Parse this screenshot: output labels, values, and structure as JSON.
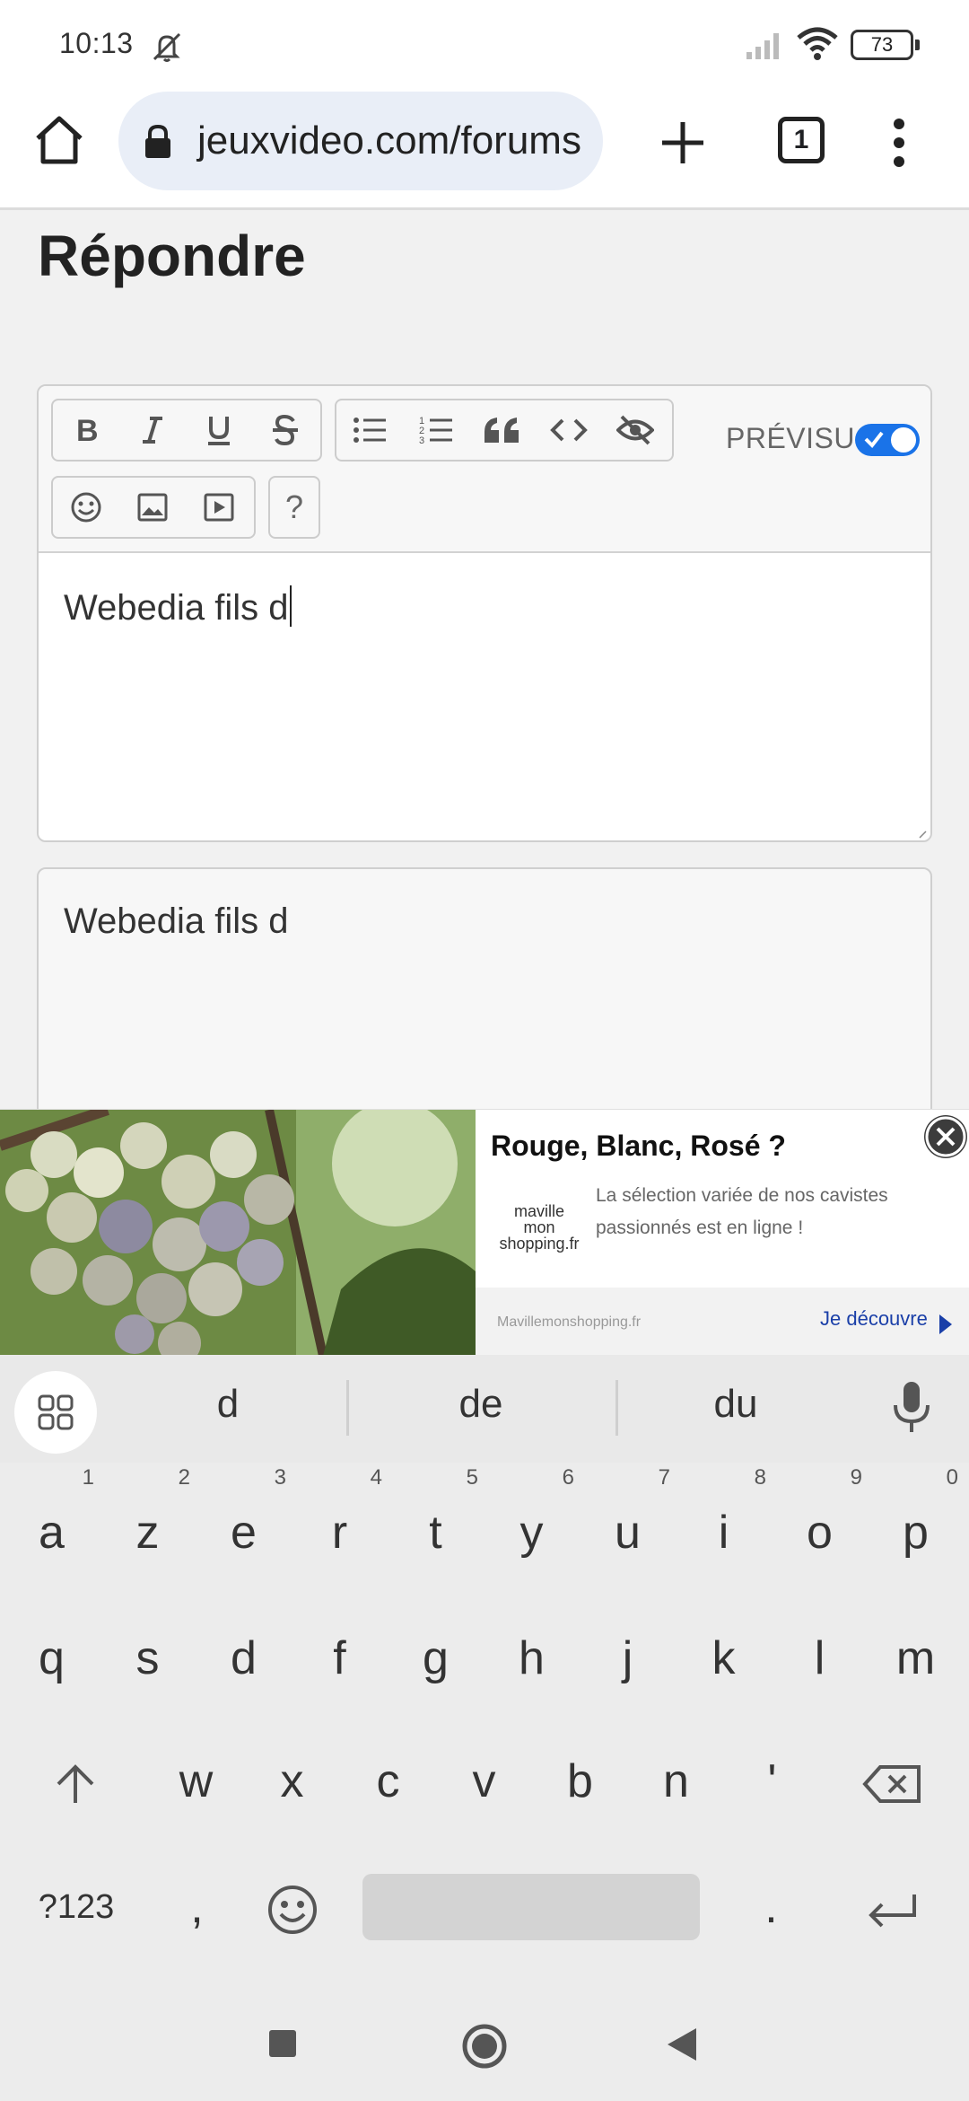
{
  "status_bar": {
    "time": "10:13",
    "battery": "73",
    "icons": [
      "bell-muted-icon",
      "signal-icon",
      "wifi-icon",
      "battery-icon"
    ]
  },
  "browser": {
    "url": "jeuxvideo.com/forums",
    "tab_count": "1",
    "icons": [
      "home-icon",
      "lock-icon",
      "plus-icon",
      "menu-dots-icon"
    ]
  },
  "page": {
    "title": "Répondre"
  },
  "editor": {
    "toolbar_group1": [
      "bold-icon",
      "italic-icon",
      "underline-icon",
      "strikethrough-icon"
    ],
    "toolbar_group2": [
      "bullet-list-icon",
      "numbered-list-icon",
      "quote-icon",
      "code-icon",
      "spoiler-icon"
    ],
    "toolbar_group3": [
      "emoji-icon",
      "image-icon",
      "video-icon"
    ],
    "help_label": "?",
    "preview_label": "PRÉVISU",
    "preview_enabled": true,
    "text": "Webedia fils d"
  },
  "preview": {
    "text": "Webedia fils d"
  },
  "ad": {
    "title": "Rouge, Blanc, Rosé ?",
    "logo_line1": "maville",
    "logo_line2": "mon",
    "logo_line3": "shopping.fr",
    "description": "La sélection variée de nos cavistes passionnés est en ligne !",
    "source": "Mavillemonshopping.fr",
    "cta": "Je découvre"
  },
  "keyboard": {
    "suggestions": [
      "d",
      "de",
      "du"
    ],
    "row1": [
      {
        "key": "a",
        "alt": "1"
      },
      {
        "key": "z",
        "alt": "2"
      },
      {
        "key": "e",
        "alt": "3"
      },
      {
        "key": "r",
        "alt": "4"
      },
      {
        "key": "t",
        "alt": "5"
      },
      {
        "key": "y",
        "alt": "6"
      },
      {
        "key": "u",
        "alt": "7"
      },
      {
        "key": "i",
        "alt": "8"
      },
      {
        "key": "o",
        "alt": "9"
      },
      {
        "key": "p",
        "alt": "0"
      }
    ],
    "row2": [
      "q",
      "s",
      "d",
      "f",
      "g",
      "h",
      "j",
      "k",
      "l",
      "m"
    ],
    "row3": [
      "w",
      "x",
      "c",
      "v",
      "b",
      "n",
      "'"
    ],
    "symbols_key": "?123",
    "comma_key": ",",
    "period_key": "."
  },
  "nav_bar": {
    "icons": [
      "recents-square-icon",
      "home-circle-icon",
      "back-triangle-icon"
    ]
  }
}
